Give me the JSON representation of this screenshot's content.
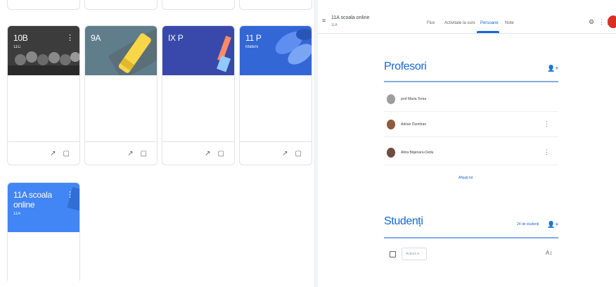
{
  "left": {
    "cards": [
      {
        "title": "10B",
        "subtitle": "11C",
        "color": "#4a4a4a"
      },
      {
        "title": "9A",
        "subtitle": "",
        "color": "#607d8b"
      },
      {
        "title": "IX P",
        "subtitle": "",
        "color": "#3949ab"
      },
      {
        "title": "11 P",
        "subtitle": "Materii",
        "color": "#3367d6"
      },
      {
        "title": "11A scoala online",
        "subtitle": "11A",
        "color": "#4285f4"
      }
    ]
  },
  "header": {
    "class_title": "11A scoala online",
    "class_sub": "11A",
    "tabs": [
      "Flux",
      "Activitate la curs",
      "Persoane",
      "Note"
    ],
    "active_tab": "Persoane"
  },
  "teachers": {
    "title": "Profesori",
    "items": [
      {
        "name": "prof Maria Toma",
        "avatar_color": "#9e9e9e"
      },
      {
        "name": "Adrian Dumitran",
        "avatar_color": "#8d5a3b"
      },
      {
        "name": "Alina Bâjenaru-Oedu",
        "avatar_color": "#6d4c41"
      }
    ],
    "show_all": "Afișați tot"
  },
  "students": {
    "title": "Studenți",
    "count": "24 de studenți",
    "actions_label": "Acțiuni ▾"
  },
  "colors": {
    "accent": "#1967d2",
    "avatar": "#d93025"
  }
}
